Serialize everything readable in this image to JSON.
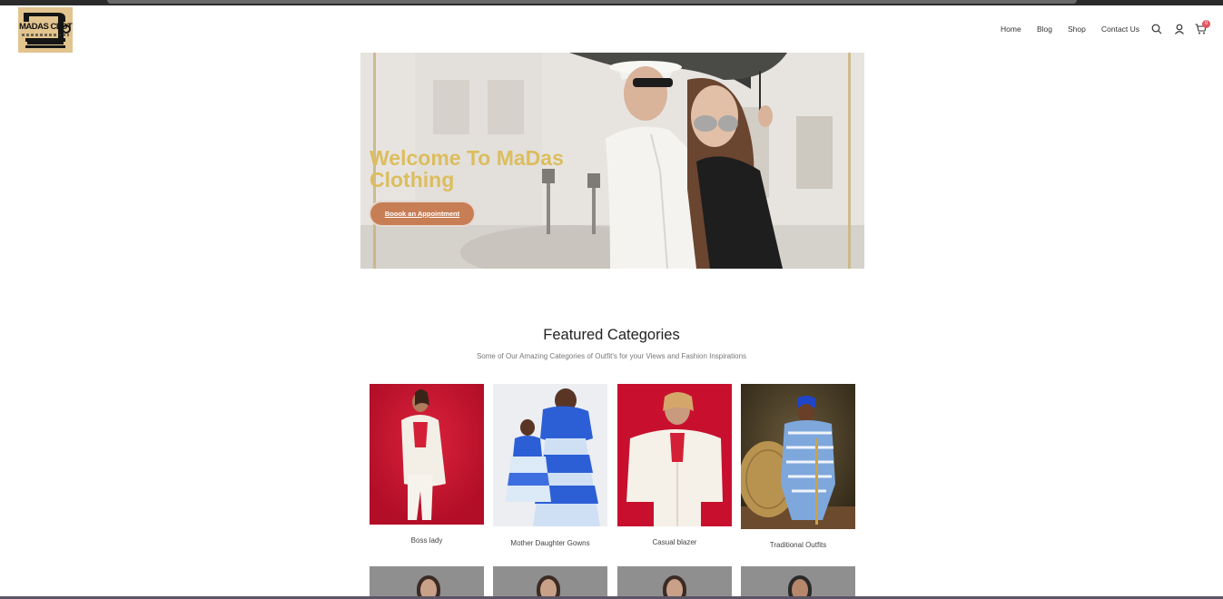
{
  "brand": {
    "logo_text": "MADAS CLOTHING"
  },
  "nav": {
    "items": [
      "Home",
      "Blog",
      "Shop",
      "Contact Us"
    ],
    "cart_count": "0"
  },
  "hero": {
    "title": "Welcome To MaDas Clothing",
    "button_label": "Boook an Appointment"
  },
  "featured": {
    "title": "Featured Categories",
    "subtitle": "Some of Our Amazing Categories of Outfit's for your Views and Fashion Inspirations",
    "categories": [
      {
        "label": "Boss lady"
      },
      {
        "label": "Mother Daughter Gowns"
      },
      {
        "label": "Casual blazer"
      },
      {
        "label": "Traditional Outfits"
      }
    ]
  },
  "colors": {
    "hero_title": "#dcbd5e",
    "button": "#c87e55",
    "badge": "#e0555f",
    "card_red": "#c8102e",
    "card_blue": "#2c5fd6"
  },
  "icons": [
    "search-icon",
    "user-icon",
    "cart-icon"
  ]
}
